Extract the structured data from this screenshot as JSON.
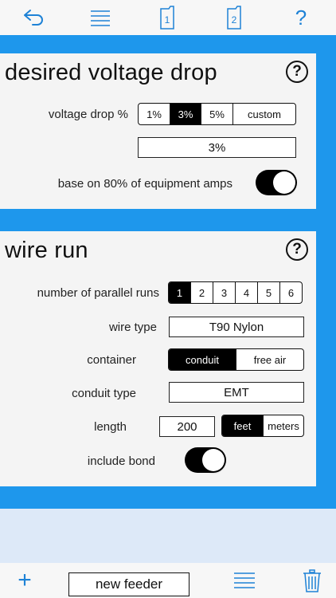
{
  "toolbar": {
    "icons": [
      "back-arrow-icon",
      "menu-icon",
      "page-1-icon",
      "page-2-icon",
      "help-icon"
    ],
    "page1_label": "1",
    "page2_label": "2",
    "help_label": "?",
    "accent_color": "#1e82d6"
  },
  "voltage_panel": {
    "title": "desired voltage drop",
    "help": "?",
    "vd_label": "voltage drop %",
    "vd_options": [
      "1%",
      "3%",
      "5%",
      "custom"
    ],
    "vd_selected": "3%",
    "vd_value": "3%",
    "base_label": "base on 80% of equipment amps",
    "base_on": true
  },
  "wire_panel": {
    "title": "wire run",
    "help": "?",
    "parallel_label": "number of parallel runs",
    "parallel_options": [
      "1",
      "2",
      "3",
      "4",
      "5",
      "6"
    ],
    "parallel_selected": "1",
    "wire_type_label": "wire type",
    "wire_type_value": "T90 Nylon",
    "container_label": "container",
    "container_options": [
      "conduit",
      "free air"
    ],
    "container_selected": "conduit",
    "conduit_type_label": "conduit type",
    "conduit_type_value": "EMT",
    "length_label": "length",
    "length_value": "200",
    "unit_options": [
      "feet",
      "meters"
    ],
    "unit_selected": "feet",
    "bond_label": "include bond",
    "bond_on": true
  },
  "bottom": {
    "add_label": "+",
    "new_feeder_label": "new feeder"
  }
}
